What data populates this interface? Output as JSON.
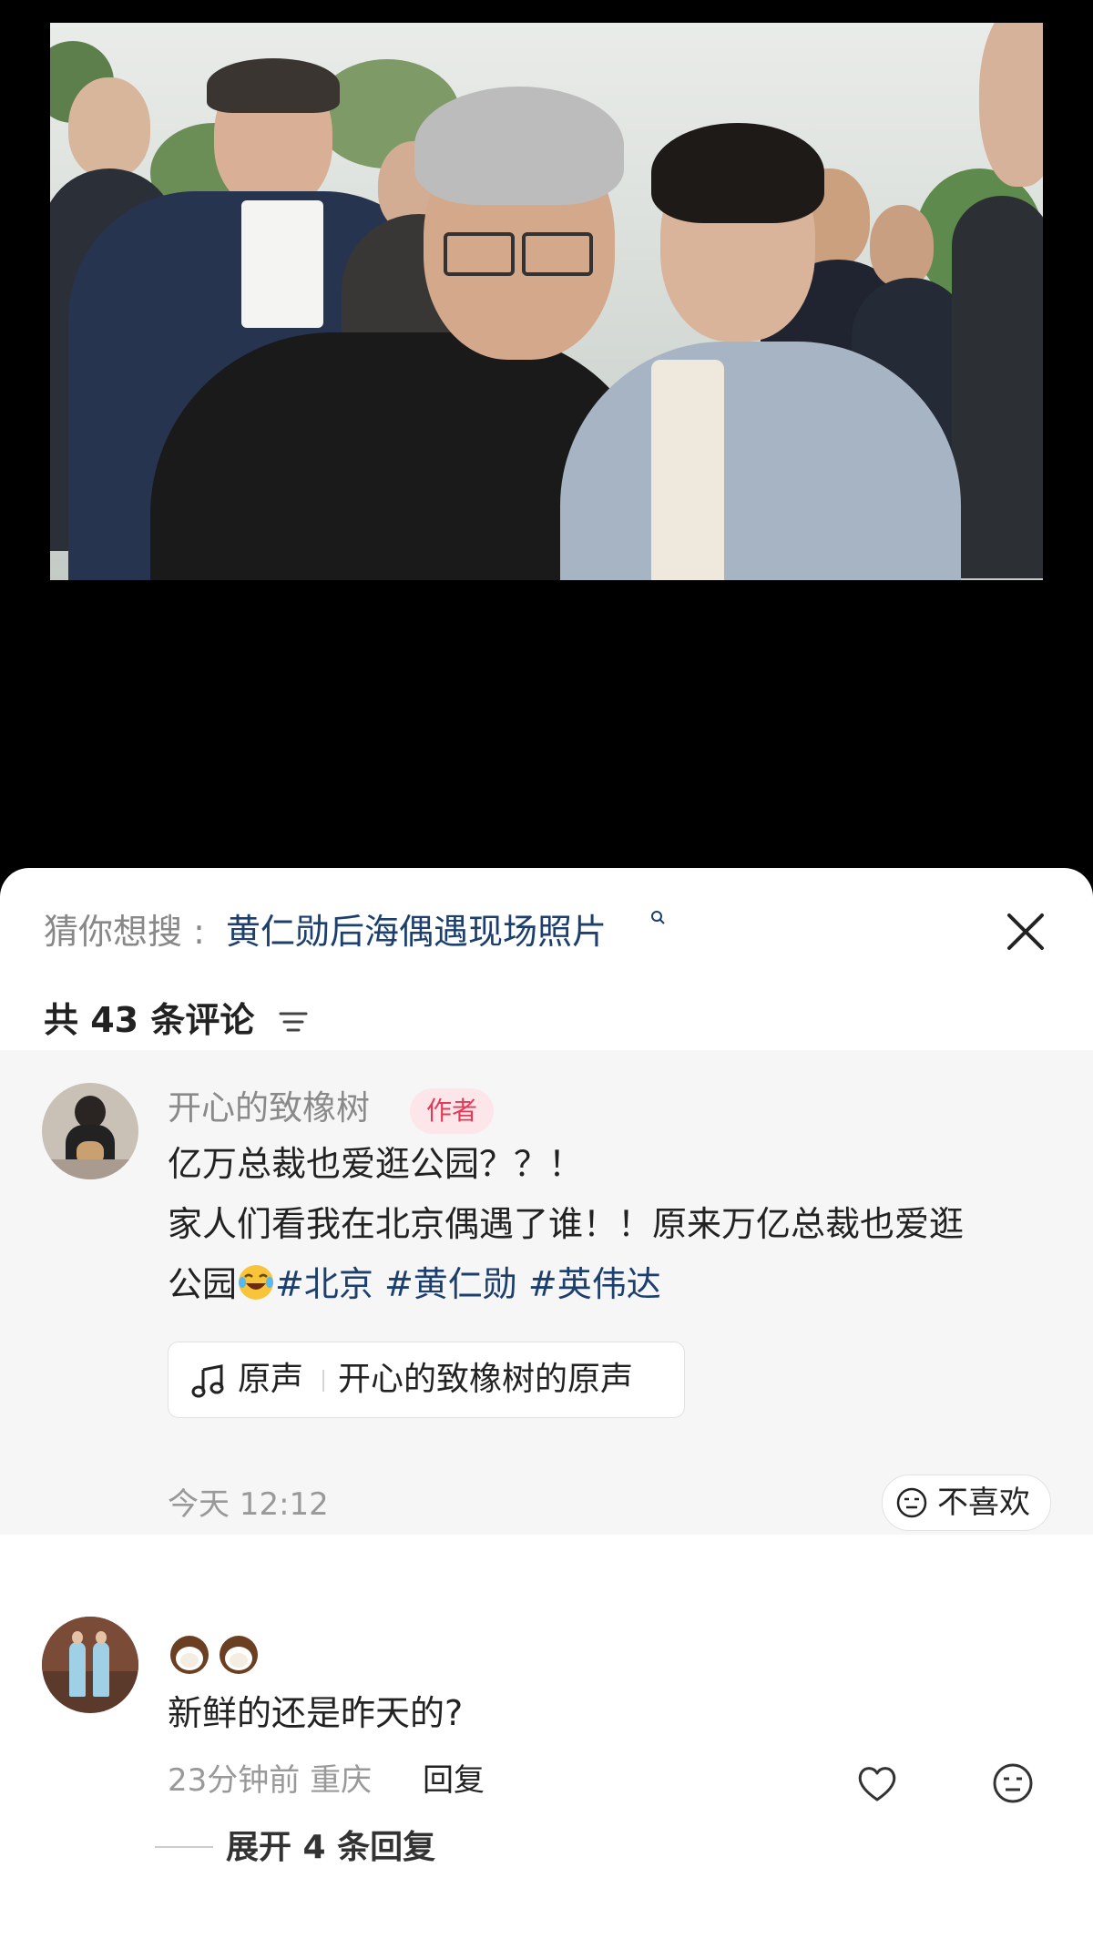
{
  "search": {
    "prefix": "猜你想搜 :",
    "query": "黄仁勋后海偶遇现场照片"
  },
  "comments_header": {
    "count_label": "共 43 条评论"
  },
  "author_comment": {
    "name": "开心的致橡树",
    "badge": "作者",
    "line1": "亿万总裁也爱逛公园？？！",
    "line2": "家人们看我在北京偶遇了谁！！原来万亿总裁也爱逛",
    "line3_prefix": "公园",
    "tags": [
      "#北京",
      "#黄仁勋",
      "#英伟达"
    ],
    "sound_label": "原声",
    "sound_name": "开心的致橡树的原声",
    "time": "今天 12:12",
    "dislike_label": "不喜欢"
  },
  "reply": {
    "text": "新鲜的还是昨天的?",
    "meta": "23分钟前 重庆",
    "reply_label": "回复",
    "expand_label": "展开 4 条回复"
  },
  "icons": {
    "close": "close-icon",
    "sort": "sort-icon",
    "note": "music-note-icon",
    "emoji": "laughing-emoji-icon",
    "like": "heart-icon",
    "dislike": "neutral-face-icon",
    "coconut": "coconut-emoji-icon"
  },
  "colors": {
    "tag_link": "#1c3f6e",
    "badge_text": "#e53a57",
    "badge_bg": "#fde6ea"
  }
}
